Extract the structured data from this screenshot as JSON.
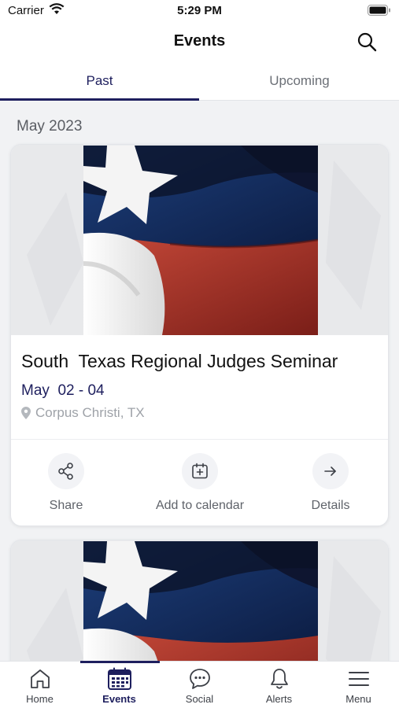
{
  "status_bar": {
    "carrier": "Carrier",
    "time": "5:29 PM"
  },
  "header": {
    "title": "Events"
  },
  "tabs": [
    {
      "label": "Past",
      "selected": true
    },
    {
      "label": "Upcoming",
      "selected": false
    }
  ],
  "section": {
    "title": "May 2023"
  },
  "events": [
    {
      "title": "South  Texas Regional Judges Seminar",
      "date": "May  02 - 04",
      "location": "Corpus Christi, TX",
      "actions": {
        "share": "Share",
        "add_to_calendar": "Add to calendar",
        "details": "Details"
      }
    }
  ],
  "bottom_nav": [
    {
      "label": "Home",
      "icon": "home-icon"
    },
    {
      "label": "Events",
      "icon": "calendar-icon",
      "active": true
    },
    {
      "label": "Social",
      "icon": "chat-bubble-icon"
    },
    {
      "label": "Alerts",
      "icon": "bell-icon"
    },
    {
      "label": "Menu",
      "icon": "hamburger-menu-icon"
    }
  ],
  "colors": {
    "accent": "#1e1f5e",
    "background": "#f1f2f4",
    "muted_text": "#9ea2a8"
  }
}
